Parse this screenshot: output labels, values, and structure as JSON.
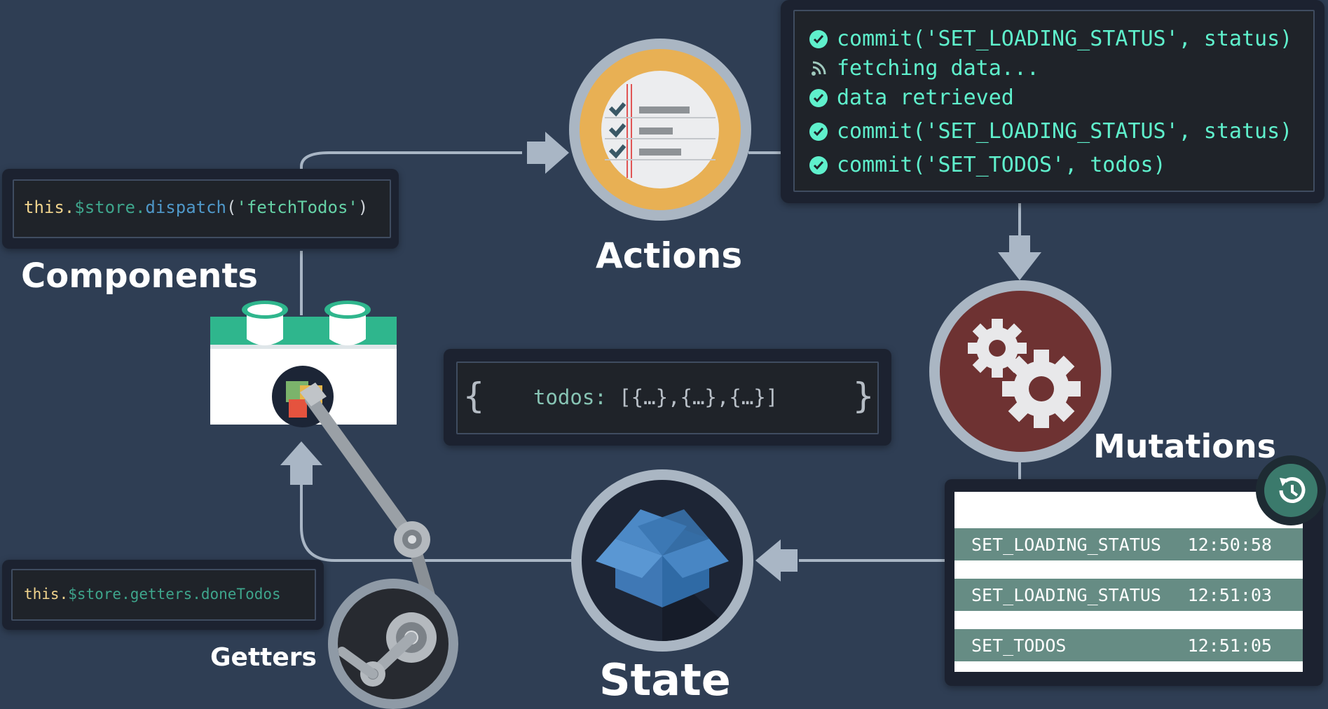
{
  "labels": {
    "components": "Components",
    "actions": "Actions",
    "mutations": "Mutations",
    "state": "State",
    "getters": "Getters"
  },
  "dispatch": {
    "this": "this.",
    "store": "$store.",
    "method": "dispatch",
    "open": "(",
    "arg": "'fetchTodos'",
    "close": ")"
  },
  "getter": {
    "this": "this.",
    "rest": "$store.getters.doneTodos"
  },
  "state_code": {
    "open": "{",
    "key": "todos: ",
    "value": "[{…},{…},{…}]",
    "close": "}"
  },
  "action_log": [
    {
      "icon": "check-circle-icon",
      "text": "commit('SET_LOADING_STATUS', status)"
    },
    {
      "icon": "signal-icon",
      "text": "fetching data..."
    },
    {
      "icon": "check-circle-icon",
      "text": "data retrieved"
    },
    {
      "icon": "check-circle-icon",
      "text": "commit('SET_LOADING_STATUS', status)"
    },
    {
      "icon": "check-circle-icon",
      "text": "commit('SET_TODOS', todos)"
    }
  ],
  "mutation_log": [
    {
      "name": "SET_LOADING_STATUS",
      "time": "12:50:58"
    },
    {
      "name": "SET_LOADING_STATUS",
      "time": "12:51:03"
    },
    {
      "name": "SET_TODOS",
      "time": "12:51:05"
    }
  ],
  "icons": {
    "actions": "checklist-icon",
    "mutations": "gears-icon",
    "state": "box-icon",
    "getters": "gear-arm-icon",
    "components": "component-block-icon",
    "history": "history-icon",
    "arrow": "arrow-icon"
  },
  "colors": {
    "background": "#2f3e54",
    "log_text": "#5ff0cc",
    "actions_circle": "#e8b054",
    "mutations_circle": "#6e3232",
    "state_circle": "#1d2535",
    "component_green": "#2fb68d",
    "mutation_row": "#668c84",
    "connector": "#a9b6c5"
  }
}
